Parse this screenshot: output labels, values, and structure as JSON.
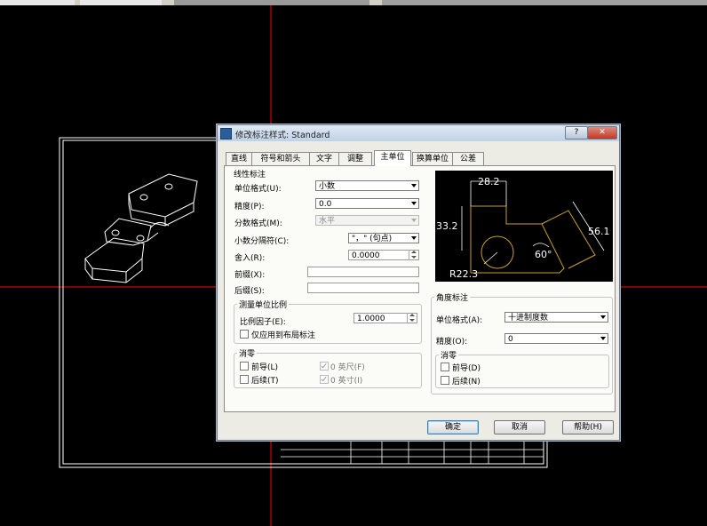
{
  "dialog": {
    "title": "修改标注样式: Standard",
    "help_caption": "?",
    "close_caption": "✕",
    "tabs": [
      "直线",
      "符号和箭头",
      "文字",
      "调整",
      "主单位",
      "换算单位",
      "公差"
    ],
    "active_tab": "主单位",
    "linear": {
      "group_title": "线性标注",
      "unit_format_label": "单位格式(U):",
      "unit_format_value": "小数",
      "precision_label": "精度(P):",
      "precision_value": "0.0",
      "fraction_format_label": "分数格式(M):",
      "fraction_format_value": "水平",
      "decimal_sep_label": "小数分隔符(C):",
      "decimal_sep_value": "\"，\"  (句点)",
      "roundoff_label": "舍入(R):",
      "roundoff_value": "0.0000",
      "prefix_label": "前缀(X):",
      "prefix_value": "",
      "suffix_label": "后缀(S):",
      "suffix_value": ""
    },
    "scale": {
      "group_title": "测量单位比例",
      "factor_label": "比例因子(E):",
      "factor_value": "1.0000",
      "layout_only_label": "仅应用到布局标注",
      "layout_only_checked": false
    },
    "zero_linear": {
      "group_title": "消零",
      "leading_label": "前导(L)",
      "trailing_label": "后续(T)",
      "feet_label": "0 英尺(F)",
      "inches_label": "0 英寸(I)",
      "leading_checked": false,
      "trailing_checked": false,
      "feet_checked": true,
      "inches_checked": true
    },
    "angular": {
      "group_title": "角度标注",
      "unit_format_label": "单位格式(A):",
      "unit_format_value": "十进制度数",
      "precision_label": "精度(O):",
      "precision_value": "0"
    },
    "zero_angular": {
      "group_title": "消零",
      "leading_label": "前导(D)",
      "trailing_label": "后续(N)",
      "leading_checked": false,
      "trailing_checked": false
    },
    "preview": {
      "dim_top": "28.2",
      "dim_left": "33.2",
      "dim_right": "56.1",
      "dim_angle": "60°",
      "dim_radius": "R22.3"
    },
    "buttons": {
      "ok": "确定",
      "cancel": "取消",
      "help": "帮助(H)"
    }
  },
  "colors": {
    "canvas_bg": "#000000",
    "crosshair": "#ff0000",
    "drawing_lines": "#ffffff",
    "preview_geometry": "#c8a032",
    "dialog_bg": "#ecebe4"
  }
}
